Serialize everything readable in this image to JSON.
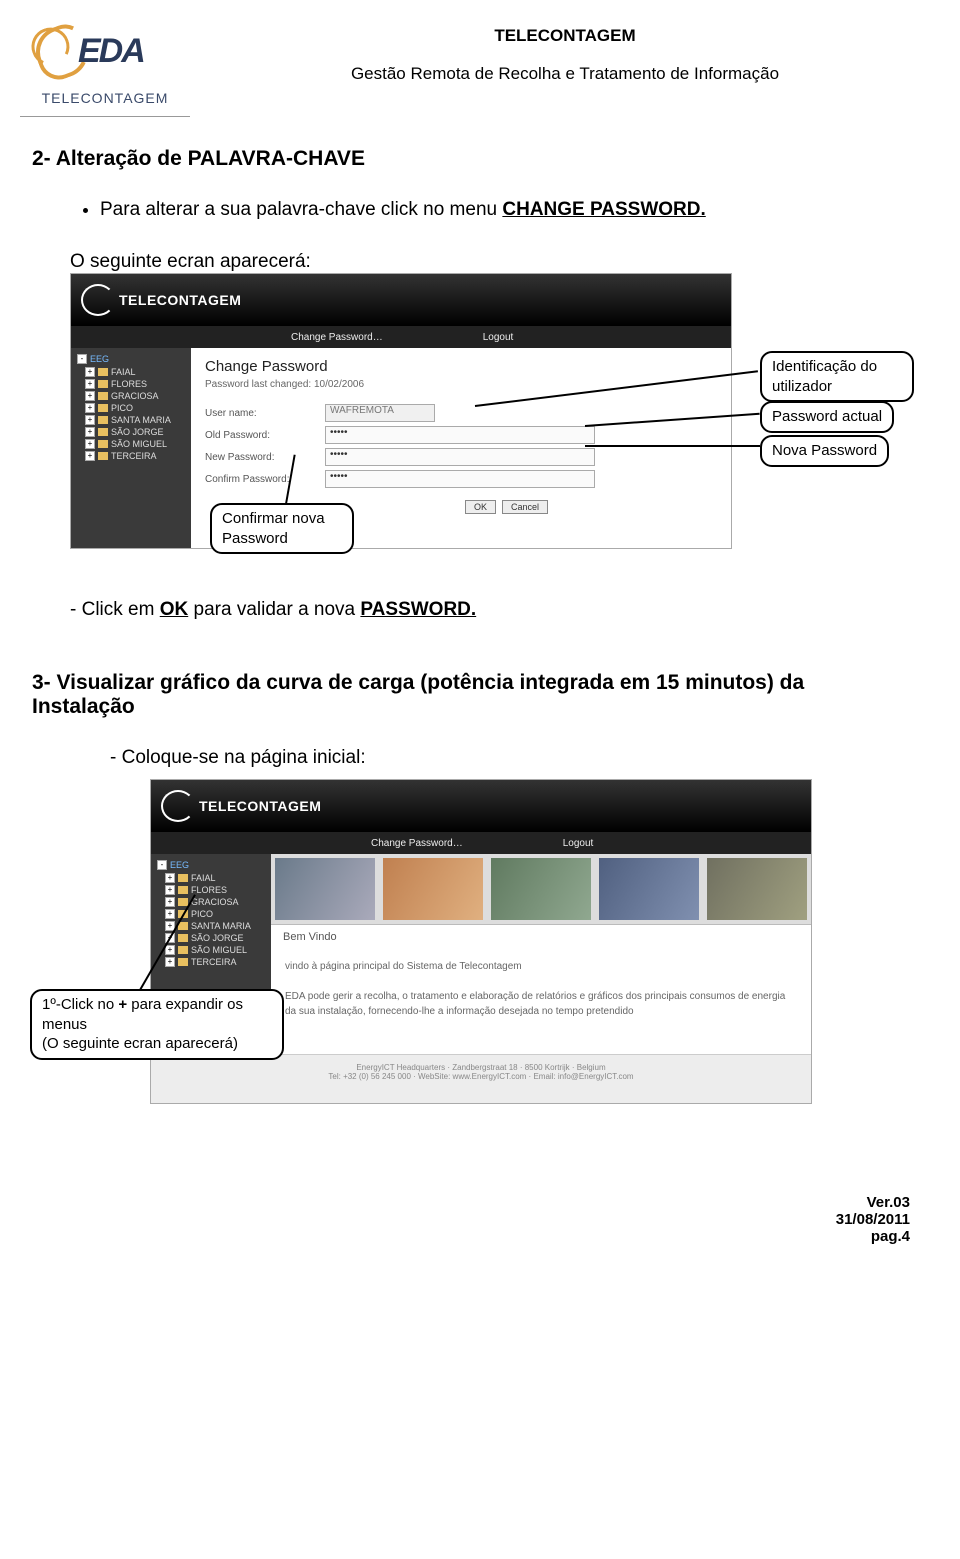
{
  "header": {
    "logo_text": "EDA",
    "logo_label": "TELECONTAGEM",
    "title": "TELECONTAGEM",
    "subtitle": "Gestão Remota de Recolha e Tratamento de Informação"
  },
  "section2_heading": "2- Alteração de PALAVRA-CHAVE",
  "section2_bullet_a": "Para alterar a sua palavra-chave click no menu ",
  "section2_bullet_a_link": "CHANGE PASSWORD.",
  "section2_intro": "O seguinte ecran aparecerá:",
  "callouts": {
    "ident": "Identificação do utilizador",
    "pass_actual": "Password actual",
    "pass_nova": "Nova Password",
    "pass_confirm": "Confirmar nova Password"
  },
  "shot1": {
    "brand": "TELECONTAGEM",
    "menu_change": "Change Password…",
    "menu_logout": "Logout",
    "tree_root": "EEG",
    "tree_items": [
      "FAIAL",
      "FLORES",
      "GRACIOSA",
      "PICO",
      "SANTA MARIA",
      "SÃO JORGE",
      "SÃO MIGUEL",
      "TERCEIRA"
    ],
    "panel_title": "Change Password",
    "panel_sub": "Password last changed: 10/02/2006",
    "lbl_user": "User name:",
    "val_user": "WAFREMOTA",
    "lbl_old": "Old Password:",
    "val_old": "•••••",
    "lbl_new": "New Password:",
    "val_new": "•••••",
    "lbl_confirm": "Confirm Password:",
    "val_confirm": "•••••",
    "btn_ok": "OK",
    "btn_cancel": "Cancel"
  },
  "section2_step": "- Click em OK para validar a nova PASSWORD.",
  "section2_step_pre": "- Click em ",
  "section2_step_ok": "OK",
  "section2_step_mid": " para validar a nova ",
  "section2_step_pass": "PASSWORD.",
  "section3_heading": "3- Visualizar gráfico da curva de carga (potência integrada em 15 minutos) da Instalação",
  "section3_intro": "- Coloque-se na página inicial:",
  "callout_expand_l1": "1º-Click no + para expandir os menus",
  "callout_expand_l2": "(O seguinte ecran aparecerá)",
  "callout_expand_pre": "1º-Click no ",
  "callout_expand_plus": "+",
  "callout_expand_post": " para expandir os menus",
  "callout_expand_paren": "(O seguinte ecran aparecerá)",
  "shot2": {
    "welcome_bar": "Bem Vindo",
    "welcome1": "vindo à página principal do Sistema de Telecontagem",
    "welcome2": "EDA pode gerir a recolha, o tratamento e elaboração de relatórios e gráficos dos principais consumos de energia da sua instalação, fornecendo-lhe a informação desejada no tempo pretendido",
    "footer1": "EnergyICT Headquarters · Zandbergstraat 18 · 8500 Kortrijk · Belgium",
    "footer2": "Tel: +32 (0) 56 245 000 · WebSite: www.EnergyICT.com · Email: info@EnergyICT.com"
  },
  "footer": {
    "ver": "Ver.03",
    "date": "31/08/2011",
    "page": "pag.4"
  }
}
